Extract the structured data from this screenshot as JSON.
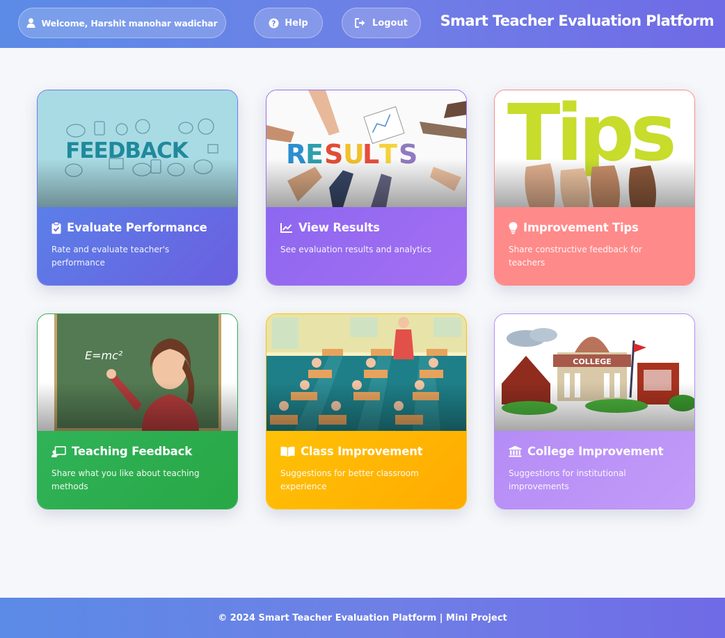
{
  "header": {
    "welcome": "Welcome, Harshit manohar wadichar",
    "help_label": "Help",
    "logout_label": "Logout",
    "app_title": "Smart Teacher Evaluation Platform"
  },
  "cards": [
    {
      "title": "Evaluate Performance",
      "description": "Rate and evaluate teacher's performance",
      "image_text": "FEEDBACK",
      "icon": "clipboard-check-icon",
      "color": "#6a6fe4"
    },
    {
      "title": "View Results",
      "description": "See evaluation results and analytics",
      "image_text": "RESULTS",
      "icon": "chart-line-icon",
      "color": "#9b6ff2"
    },
    {
      "title": "Improvement Tips",
      "description": "Share constructive feedback for teachers",
      "image_text": "Tips",
      "icon": "lightbulb-icon",
      "color": "#ff8a8a"
    },
    {
      "title": "Teaching Feedback",
      "description": "Share what you like about teaching methods",
      "image_text": "E=mc²",
      "icon": "chalkboard-teacher-icon",
      "color": "#2eb352"
    },
    {
      "title": "Class Improvement",
      "description": "Suggestions for better classroom experience",
      "icon": "book-open-icon",
      "color": "#ffb300"
    },
    {
      "title": "College Improvement",
      "description": "Suggestions for institutional improvements",
      "image_text": "COLLEGE",
      "icon": "university-icon",
      "color": "#b98cf7"
    }
  ],
  "footer": {
    "text": "© 2024 Smart Teacher Evaluation Platform | Mini Project"
  }
}
